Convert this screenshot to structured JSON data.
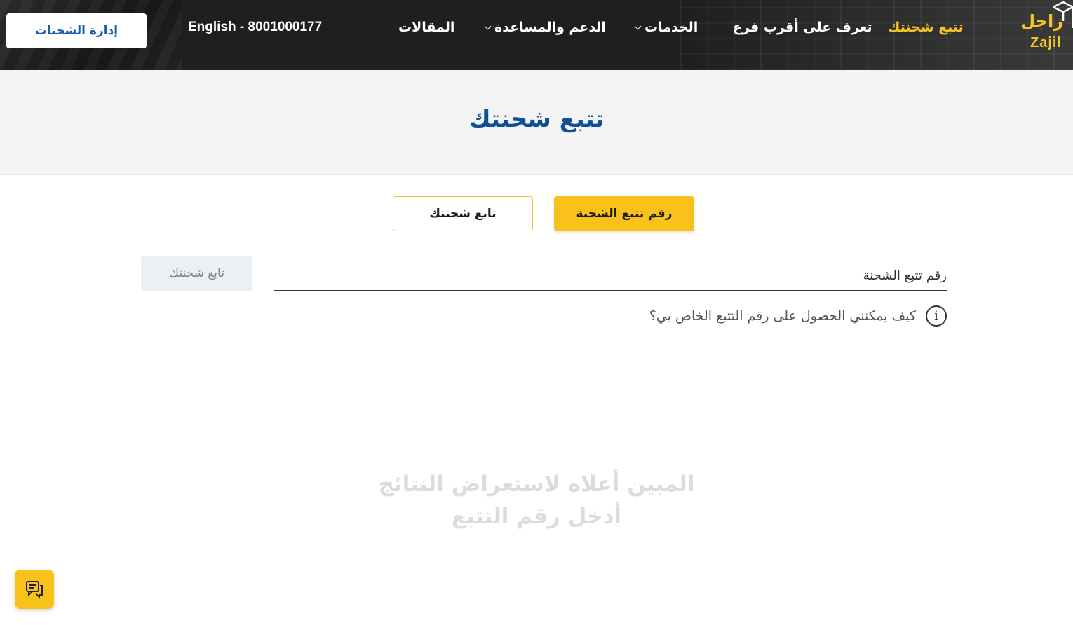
{
  "header": {
    "manage_button": "إدارة الشحنات",
    "phone": "English - 8001000177",
    "nav": {
      "track": "تتبع شحنتك",
      "branch": "تعرف على أقرب فرع",
      "services": "الخدمات",
      "support": "الدعم والمساعدة",
      "articles": "المقالات"
    },
    "logo": {
      "arabic": "زاجل",
      "english": "Zajil"
    },
    "active_color": "#f7c325"
  },
  "banner": {
    "title": "تتبع شحنتك"
  },
  "tabs": {
    "tracking_number": "رقم تتبع الشحنة",
    "follow_shipment": "تابع شحنتك"
  },
  "form": {
    "placeholder": "رقم تتبع الشحنة",
    "value": "",
    "submit": "تابع شحنتك"
  },
  "help": {
    "text": "كيف يمكنني الحصول على رقم التتبع الخاص بي؟",
    "icon": "info-icon"
  },
  "empty_state": {
    "line1": "المبين أعلاه لاستعراض النتائج",
    "line2": "أدخل رقم التتبع"
  },
  "chat": {
    "icon": "chat-icon"
  }
}
